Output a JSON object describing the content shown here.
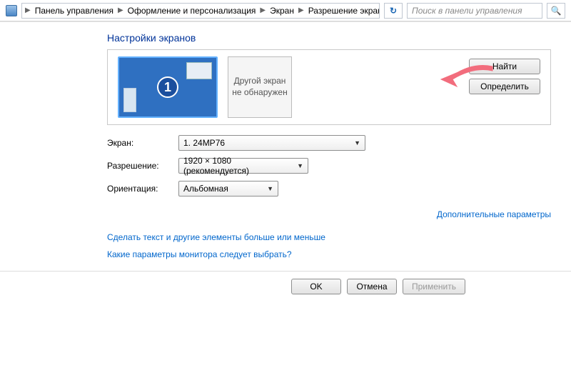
{
  "breadcrumbs": {
    "items": [
      "Панель управления",
      "Оформление и персонализация",
      "Экран",
      "Разрешение экрана"
    ]
  },
  "refresh_glyph": "↻",
  "search": {
    "placeholder": "Поиск в панели управления",
    "icon_glyph": "🔍"
  },
  "title": "Настройки экранов",
  "preview": {
    "monitor_number": "1",
    "other_text": "Другой экран не обнаружен",
    "btn_find": "Найти",
    "btn_detect": "Определить"
  },
  "form": {
    "screen_label": "Экран:",
    "screen_value": "1. 24MP76",
    "res_label": "Разрешение:",
    "res_value": "1920 × 1080 (рекомендуется)",
    "orient_label": "Ориентация:",
    "orient_value": "Альбомная"
  },
  "links": {
    "advanced": "Дополнительные параметры",
    "text_size": "Сделать текст и другие элементы больше или меньше",
    "help": "Какие параметры монитора следует выбрать?"
  },
  "buttons": {
    "ok": "OK",
    "cancel": "Отмена",
    "apply": "Применить"
  }
}
